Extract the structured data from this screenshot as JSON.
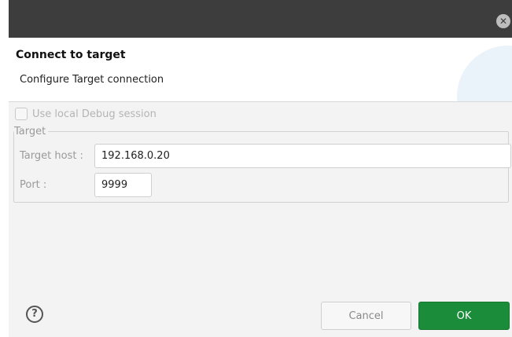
{
  "dialog": {
    "close_icon": "close-icon",
    "title": "Connect to target",
    "description": "Configure Target connection"
  },
  "options": {
    "use_local_debug_label": "Use local Debug session",
    "use_local_debug_checked": false,
    "use_local_debug_disabled": true
  },
  "target": {
    "group_label": "Target",
    "host_label": "Target host :",
    "host_value": "192.168.0.20",
    "port_label": "Port :",
    "port_value": "9999"
  },
  "footer": {
    "help_glyph": "?",
    "cancel_label": "Cancel",
    "ok_label": "OK"
  },
  "colors": {
    "titlebar": "#3d3d3d",
    "ok_button": "#1a8c3a"
  }
}
